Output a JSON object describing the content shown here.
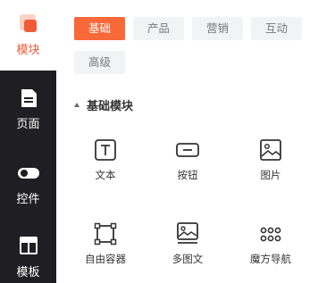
{
  "sidebar": {
    "items": [
      {
        "label": "模块",
        "icon": "modules-icon",
        "active": true
      },
      {
        "label": "页面",
        "icon": "page-icon"
      },
      {
        "label": "控件",
        "icon": "toggle-icon"
      },
      {
        "label": "模板",
        "icon": "template-icon"
      }
    ]
  },
  "tabs": [
    {
      "label": "基础",
      "active": true
    },
    {
      "label": "产品"
    },
    {
      "label": "营销"
    },
    {
      "label": "互动"
    },
    {
      "label": "高级"
    }
  ],
  "section": {
    "title": "基础模块"
  },
  "components": [
    {
      "label": "文本",
      "icon": "text-icon"
    },
    {
      "label": "按钮",
      "icon": "button-icon"
    },
    {
      "label": "图片",
      "icon": "image-icon"
    },
    {
      "label": "自由容器",
      "icon": "free-container-icon"
    },
    {
      "label": "多图文",
      "icon": "multi-image-text-icon"
    },
    {
      "label": "魔方导航",
      "icon": "grid-nav-icon"
    }
  ],
  "colors": {
    "accent": "#f8693a",
    "sidebar_bg": "#1f1f23",
    "tab_bg": "#f2f3f5"
  }
}
